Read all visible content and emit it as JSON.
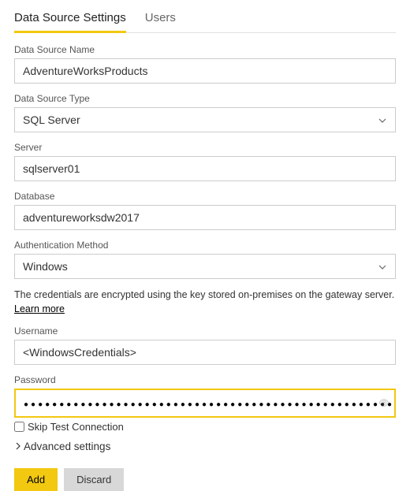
{
  "tabs": {
    "settings": "Data Source Settings",
    "users": "Users"
  },
  "fields": {
    "name_label": "Data Source Name",
    "name_value": "AdventureWorksProducts",
    "type_label": "Data Source Type",
    "type_value": "SQL Server",
    "server_label": "Server",
    "server_value": "sqlserver01",
    "database_label": "Database",
    "database_value": "adventureworksdw2017",
    "auth_label": "Authentication Method",
    "auth_value": "Windows",
    "username_label": "Username",
    "username_value": "<WindowsCredentials>",
    "password_label": "Password",
    "password_masked": "●●●●●●●●●●●●●●●●●●●●●●●●●●●●●●●●●●●●●●●●●●●●●●●●●●●●●●●●●●●●●●●●●●"
  },
  "info": {
    "text": "The credentials are encrypted using the key stored on-premises on the gateway server. ",
    "link": "Learn more"
  },
  "skip_test": "Skip Test Connection",
  "advanced": "Advanced settings",
  "buttons": {
    "add": "Add",
    "discard": "Discard"
  },
  "colors": {
    "accent": "#f2c811"
  }
}
